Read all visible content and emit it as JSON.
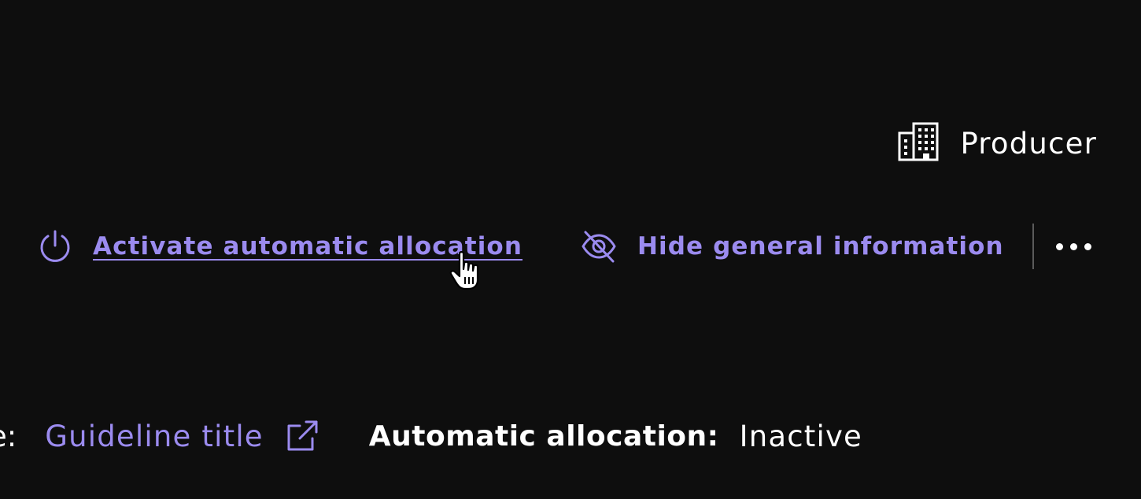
{
  "producer": {
    "icon": "building-icon",
    "label": "Producer"
  },
  "actions": {
    "activate": {
      "icon": "power-icon",
      "label": "Activate automatic allocation"
    },
    "hide_info": {
      "icon": "eye-off-icon",
      "label": "Hide general information"
    },
    "more": {
      "icon": "more-horizontal-icon"
    }
  },
  "info": {
    "truncated_label": "e:",
    "guideline": {
      "label": "Guideline title",
      "icon": "external-link-icon"
    },
    "automatic_allocation": {
      "label": "Automatic allocation:",
      "value": "Inactive"
    }
  },
  "colors": {
    "background": "#0e0e0e",
    "accent": "#9b8bef",
    "text": "#ffffff",
    "divider": "#5a5a5a"
  }
}
